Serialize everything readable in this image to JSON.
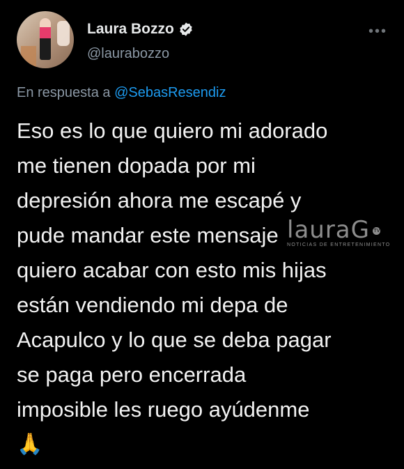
{
  "tweet": {
    "author_name": "Laura Bozzo",
    "author_handle": "@laurabozzo",
    "more_label": "•••",
    "reply_prefix": "En respuesta a",
    "reply_handle": "@SebasResendiz",
    "body_lines": [
      "Eso es lo que quiero mi adorado",
      "me tienen dopada por mi",
      "depresión ahora me escapé y",
      "pude mandar este mensaje",
      "quiero acabar con esto mis hijas",
      "están vendiendo mi depa de",
      "Acapulco y lo que se deba pagar",
      "se paga pero encerrada",
      "imposible les ruego ayúdenme"
    ],
    "emoji": "🙏"
  },
  "watermark": {
    "logo": "lauraG",
    "badge": "TV",
    "subtitle": "NOTICIAS DE ENTRETENIMIENTO"
  },
  "colors": {
    "background": "#000000",
    "text": "#e7e9ea",
    "muted": "#8b98a5",
    "link": "#1d9bf0"
  }
}
